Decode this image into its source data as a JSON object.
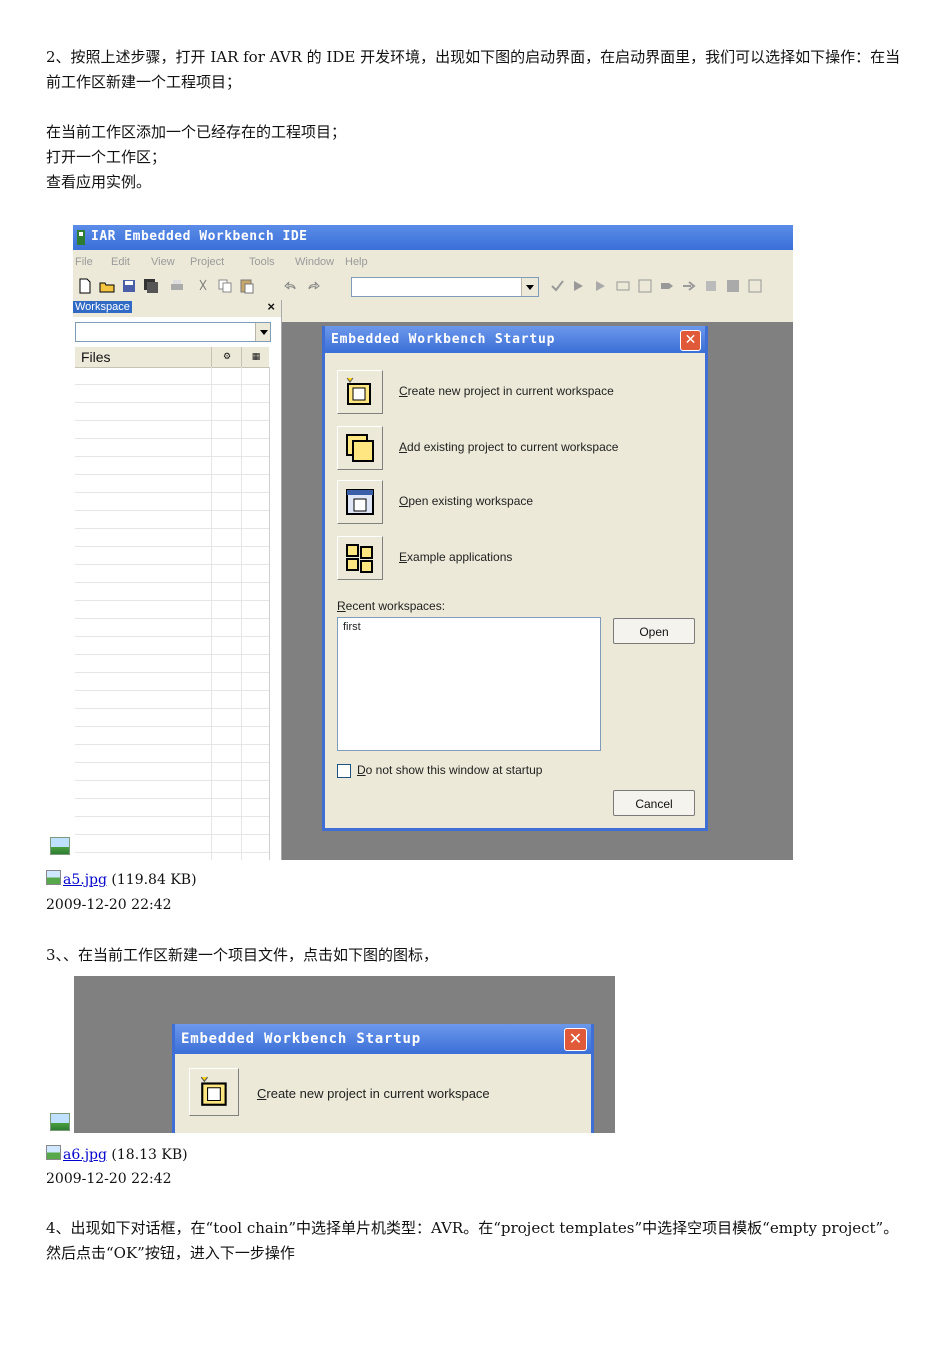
{
  "step2": {
    "paragraph": "2、按照上述步骤，打开 IAR for AVR 的 IDE 开发环境，出现如下图的启动界面，在启动界面里，我们可以选择如下操作：在当前工作区新建一个工程项目；",
    "items": [
      "在当前工作区添加一个已经存在的工程项目；",
      "打开一个工作区；",
      "查看应用实例。"
    ]
  },
  "ide": {
    "window_title": "IAR Embedded Workbench IDE",
    "menu": [
      "File",
      "Edit",
      "View",
      "Project",
      "Tools",
      "Window",
      "Help"
    ],
    "workspace_title": "Workspace",
    "workspace_close": "×",
    "files_header": "Files"
  },
  "startup_dialog": {
    "title": "Embedded Workbench Startup",
    "close": "✕",
    "options": [
      {
        "key": "C",
        "rest": "reate new project in current workspace",
        "icon": "create-project-icon"
      },
      {
        "key": "A",
        "rest": "dd existing project to current workspace",
        "icon": "add-project-icon"
      },
      {
        "key": "O",
        "rest": "pen existing workspace",
        "icon": "open-workspace-icon"
      },
      {
        "key": "E",
        "rest": "xample applications",
        "icon": "example-applications-icon"
      }
    ],
    "recent_key": "R",
    "recent_rest": "ecent workspaces:",
    "recent_items": [
      "first"
    ],
    "open_button": "Open",
    "checkbox_key": "D",
    "checkbox_rest": "o not show this window at startup",
    "cancel_button": "Cancel"
  },
  "attachment1": {
    "link": "a5.jpg",
    "size": "(119.84 KB)",
    "date": "2009-12-20 22:42"
  },
  "step3": {
    "paragraph": "3、、在当前工作区新建一个项目文件，点击如下图的图标，"
  },
  "crop_dialog": {
    "title": "Embedded Workbench Startup",
    "close": "✕",
    "option_key": "C",
    "option_rest": "reate new project in current workspace"
  },
  "attachment2": {
    "link": "a6.jpg",
    "size": "(18.13 KB)",
    "date": "2009-12-20 22:42"
  },
  "step4": {
    "paragraph": "4、出现如下对话框，在“tool chain”中选择单片机类型：AVR。在“project templates”中选择空项目模板“empty project”。然后点击“OK”按钮，进入下一步操作"
  }
}
